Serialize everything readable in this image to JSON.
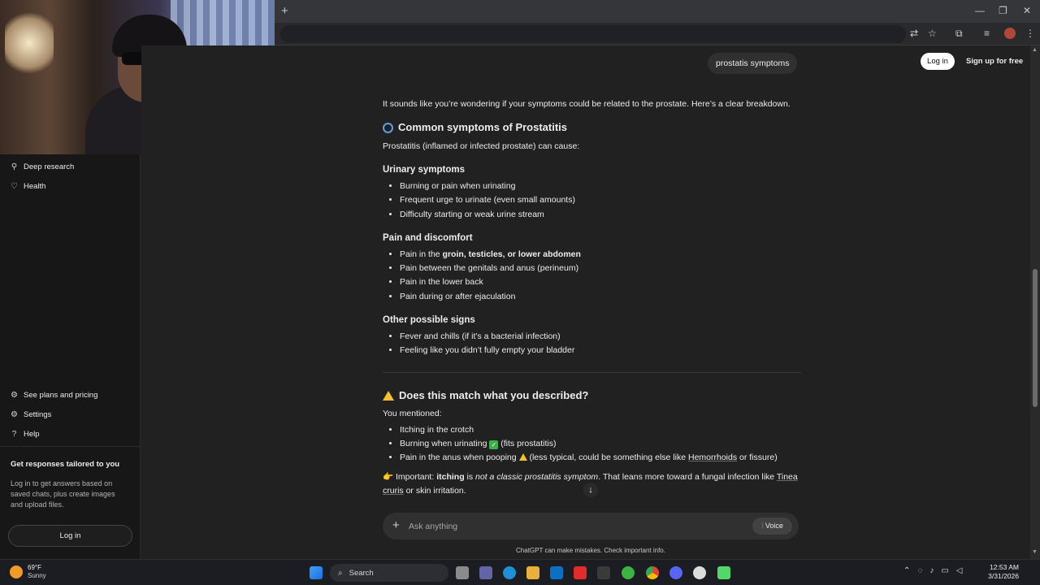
{
  "browser": {
    "new_tab_glyph": "+",
    "minimize_glyph": "—",
    "restore_glyph": "❐",
    "close_glyph": "✕"
  },
  "sidebar": {
    "items_top": [
      {
        "label": "Deep research",
        "icon": "telescope-icon",
        "glyph": "⚲"
      },
      {
        "label": "Health",
        "icon": "heart-icon",
        "glyph": "♡"
      }
    ],
    "items_bottom": [
      {
        "label": "See plans and pricing",
        "icon": "plans-icon",
        "glyph": "⚙"
      },
      {
        "label": "Settings",
        "icon": "gear-icon",
        "glyph": "⚙"
      },
      {
        "label": "Help",
        "icon": "help-icon",
        "glyph": "?"
      }
    ],
    "promo": {
      "title": "Get responses tailored to you",
      "text": "Log in to get answers based on saved chats, plus create images and upload files.",
      "button": "Log in"
    }
  },
  "header": {
    "login": "Log in",
    "signup": "Sign up for free"
  },
  "conversation": {
    "user_message": "prostatis symptoms",
    "intro": "It sounds like you’re wondering if your symptoms could be related to the prostate. Here’s a clear breakdown.",
    "section1_title": "Common symptoms of Prostatitis",
    "section1_intro": "Prostatitis (inflamed or infected prostate) can cause:",
    "urinary_title": "Urinary symptoms",
    "urinary": [
      "Burning or pain when urinating",
      "Frequent urge to urinate (even small amounts)",
      "Difficulty starting or weak urine stream"
    ],
    "pain_title": "Pain and discomfort",
    "pain": {
      "p1_prefix": "Pain in the ",
      "p1_bold": "groin, testicles, or lower abdomen",
      "items": [
        "Pain between the genitals and anus (perineum)",
        "Pain in the lower back",
        "Pain during or after ejaculation"
      ]
    },
    "other_title": "Other possible signs",
    "other": [
      "Fever and chills (if it’s a bacterial infection)",
      "Feeling like you didn’t fully empty your bladder"
    ],
    "section2_title": "Does this match what you described?",
    "mentioned_label": "You mentioned:",
    "mentioned": {
      "m1": "Itching in the crotch",
      "m2_text": "Burning when urinating",
      "m2_note": "(fits prostatitis)",
      "m3_text": "Pain in the anus when pooping",
      "m3_note_a": "(less typical, could be something else like ",
      "m3_link": "Hemorrhoids",
      "m3_note_b": " or fissure)"
    },
    "important": {
      "pointer": "👉",
      "label": "Important: ",
      "bold": "itching",
      "is": " is ",
      "italic": "not a classic prostatitis symptom",
      "rest": ". That leans more toward a fungal infection like ",
      "link": "Tinea cruris",
      "tail": " or skin irritation."
    }
  },
  "composer": {
    "placeholder": "Ask anything",
    "voice": "Voice",
    "disclaimer": "ChatGPT can make mistakes. Check important info."
  },
  "taskbar": {
    "weather_temp": "69°F",
    "weather_cond": "Sunny",
    "search_label": "Search",
    "time": "12:53 AM",
    "date": "3/31/2026"
  },
  "colors": {
    "background": "#212121",
    "sidebar": "#171717",
    "bubble": "#303030",
    "text": "#ececec"
  }
}
